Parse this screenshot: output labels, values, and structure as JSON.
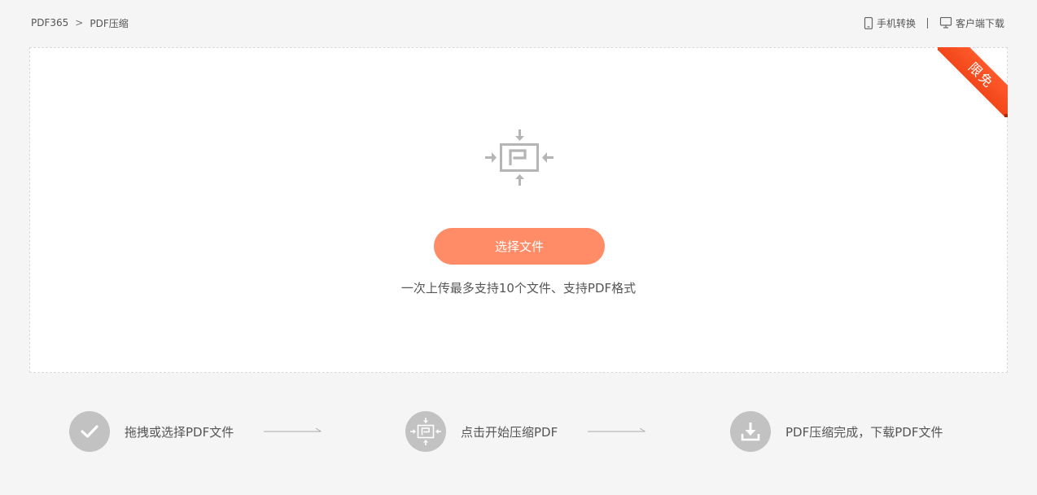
{
  "breadcrumb": {
    "home": "PDF365",
    "separator": ">",
    "current": "PDF压缩"
  },
  "top_links": {
    "mobile": "手机转换",
    "client_download": "客户端下载"
  },
  "upload": {
    "ribbon": "限免",
    "select_button": "选择文件",
    "hint": "一次上传最多支持10个文件、支持PDF格式"
  },
  "steps": [
    {
      "label": "拖拽或选择PDF文件",
      "icon": "check-icon"
    },
    {
      "label": "点击开始压缩PDF",
      "icon": "compress-icon"
    },
    {
      "label": "PDF压缩完成，下载PDF文件",
      "icon": "download-icon"
    }
  ],
  "colors": {
    "accent": "#ff8c66",
    "ribbon": "#f1461a",
    "step_icon_bg": "#c2c2c2",
    "page_bg": "#f5f5f5"
  }
}
